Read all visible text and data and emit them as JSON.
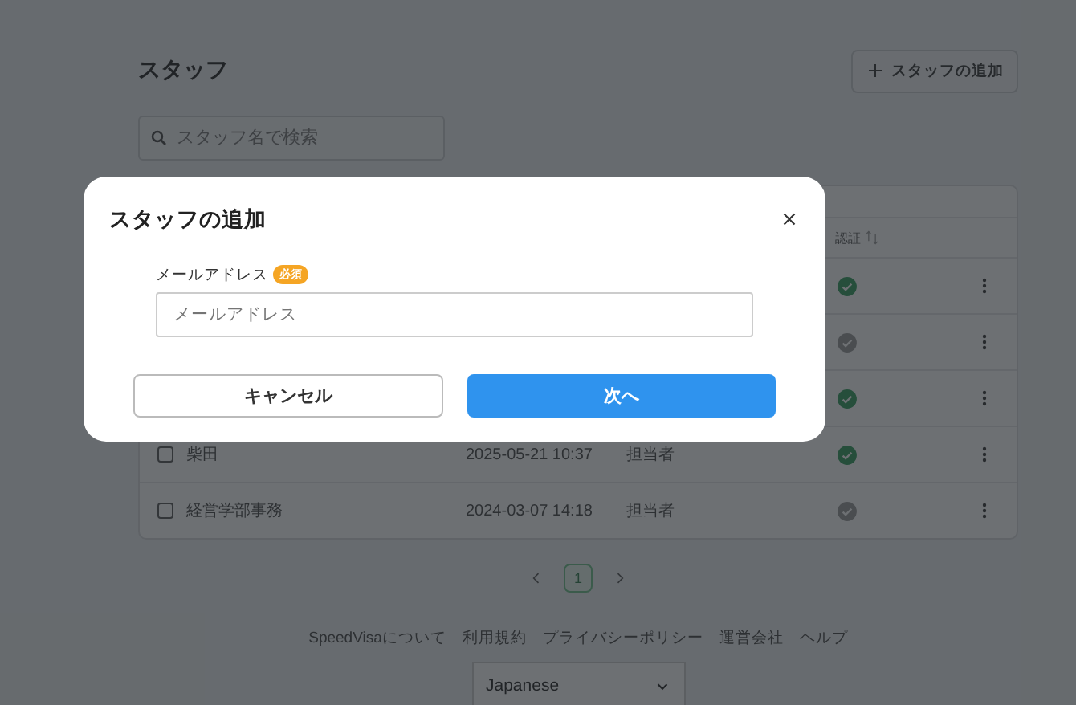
{
  "page": {
    "title": "スタッフ",
    "add_button": "スタッフの追加",
    "search": {
      "placeholder": "スタッフ名で検索"
    }
  },
  "table": {
    "columns": [
      {
        "label": "認証",
        "sortable": true
      }
    ],
    "rows": [
      {
        "verified": true
      },
      {
        "verified": false
      },
      {
        "verified": true
      },
      {
        "name": "柴田",
        "date": "2025-05-21 10:37",
        "role": "担当者",
        "checked": false,
        "verified": true
      },
      {
        "name": "経営学部事務",
        "date": "2024-03-07 14:18",
        "role": "担当者",
        "checked": false,
        "verified": false
      }
    ]
  },
  "pagination": {
    "pages": [
      {
        "label": "1",
        "selected": true
      }
    ]
  },
  "footer": {
    "links": [
      "SpeedVisaについて",
      "利用規約",
      "プライバシーポリシー",
      "運営会社",
      "ヘルプ"
    ],
    "language": "Japanese"
  },
  "dialog": {
    "title": "スタッフの追加",
    "field": {
      "label": "メールアドレス",
      "required_badge": "必須",
      "placeholder": "メールアドレス"
    },
    "cancel": "キャンセル",
    "next": "次へ"
  }
}
